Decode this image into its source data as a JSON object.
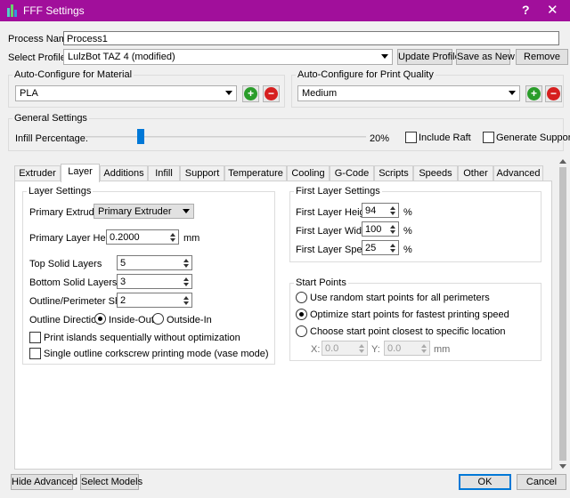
{
  "window": {
    "title": "FFF Settings",
    "help": "?",
    "close": "✕"
  },
  "process": {
    "label": "Process Name:",
    "value": "Process1"
  },
  "profile": {
    "label": "Select Profile:",
    "value": "LulzBot TAZ 4 (modified)",
    "update": "Update Profile",
    "save_as_new": "Save as New",
    "remove": "Remove"
  },
  "material": {
    "title": "Auto-Configure for Material",
    "value": "PLA"
  },
  "quality": {
    "title": "Auto-Configure for Print Quality",
    "value": "Medium"
  },
  "general": {
    "title": "General Settings",
    "infill_label": "Infill Percentage:",
    "infill_value": "20%",
    "infill_fraction": 0.2,
    "include_raft": "Include Raft",
    "generate_support": "Generate Support"
  },
  "tabs": [
    "Extruder",
    "Layer",
    "Additions",
    "Infill",
    "Support",
    "Temperature",
    "Cooling",
    "G-Code",
    "Scripts",
    "Speeds",
    "Other",
    "Advanced"
  ],
  "active_tab": "Layer",
  "layer": {
    "title": "Layer Settings",
    "primary_extruder_label": "Primary Extruder",
    "primary_extruder_value": "Primary Extruder",
    "primary_layer_height_label": "Primary Layer Height",
    "primary_layer_height_value": "0.2000",
    "primary_layer_height_unit": "mm",
    "top_solid_label": "Top Solid Layers",
    "top_solid_value": "5",
    "bottom_solid_label": "Bottom Solid Layers",
    "bottom_solid_value": "3",
    "outline_shells_label": "Outline/Perimeter Shells",
    "outline_shells_value": "2",
    "outline_direction_label": "Outline Direction:",
    "inside_out": "Inside-Out",
    "outside_in": "Outside-In",
    "print_islands": "Print islands sequentially without optimization",
    "single_outline": "Single outline corkscrew printing mode (vase mode)"
  },
  "first_layer": {
    "title": "First Layer Settings",
    "height_label": "First Layer Height",
    "height_value": "94",
    "width_label": "First Layer Width",
    "width_value": "100",
    "speed_label": "First Layer Speed",
    "speed_value": "25",
    "unit": "%"
  },
  "start_points": {
    "title": "Start Points",
    "random": "Use random start points for all perimeters",
    "optimize": "Optimize start points for fastest printing speed",
    "closest": "Choose start point closest to specific location",
    "x_label": "X:",
    "x_value": "0.0",
    "y_label": "Y:",
    "y_value": "0.0",
    "unit": "mm"
  },
  "footer": {
    "hide_advanced": "Hide Advanced",
    "select_models": "Select Models",
    "ok": "OK",
    "cancel": "Cancel"
  },
  "colors": {
    "titlebar": "#a10f9b",
    "accent": "#0078d7",
    "add": "#2a9d2a",
    "remove": "#d61f1f"
  }
}
